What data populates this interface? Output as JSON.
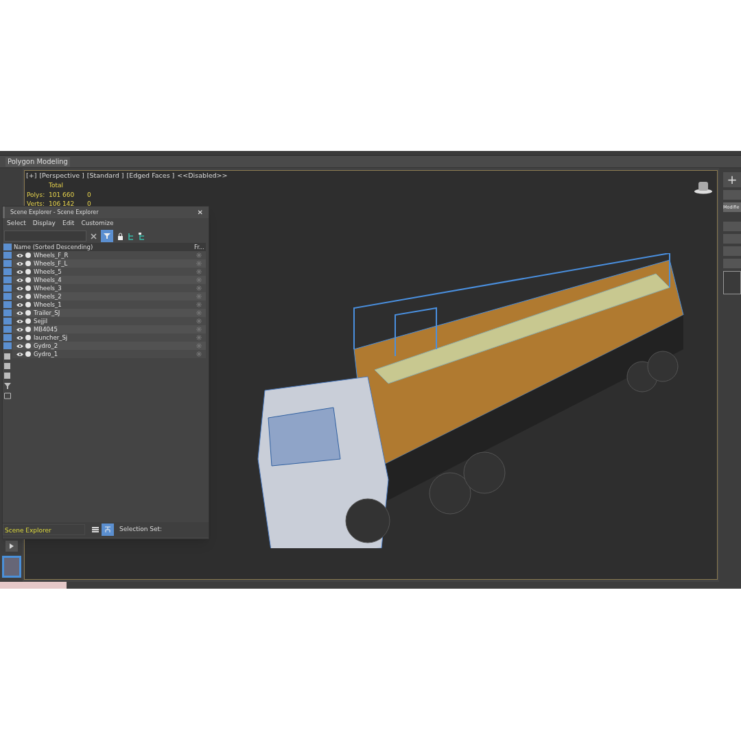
{
  "ribbon": {
    "panel_label": "Polygon Modeling"
  },
  "viewport": {
    "labels": [
      "[+]",
      "[Perspective ]",
      "[Standard ]",
      "[Edged Faces ]",
      "<<Disabled>>"
    ],
    "stats": {
      "header": "Total",
      "rows": [
        {
          "label": "Polys:",
          "total": "101 660",
          "selected": "0"
        },
        {
          "label": "Verts:",
          "total": "106 142",
          "selected": "0"
        }
      ]
    }
  },
  "scene_explorer": {
    "title": "Scene Explorer - Scene Explorer",
    "close": "✕",
    "menu": [
      "Select",
      "Display",
      "Edit",
      "Customize"
    ],
    "columns": [
      "Name (Sorted Descending)",
      "Fr..."
    ],
    "rows": [
      {
        "name": "Wheels_F_R"
      },
      {
        "name": "Wheels_F_L"
      },
      {
        "name": "Wheels_5"
      },
      {
        "name": "Wheels_4"
      },
      {
        "name": "Wheels_3"
      },
      {
        "name": "Wheels_2"
      },
      {
        "name": "Wheels_1"
      },
      {
        "name": "Trailer_SJ"
      },
      {
        "name": "Sejjil"
      },
      {
        "name": "MB4045"
      },
      {
        "name": "launcher_Sj"
      },
      {
        "name": "Gydro_2"
      },
      {
        "name": "Gydro_1"
      }
    ],
    "footer": {
      "explorer_name": "Scene Explorer",
      "selection_set_label": "Selection Set:"
    }
  },
  "command_panel": {
    "plus": "+",
    "tab": "Modifie"
  }
}
